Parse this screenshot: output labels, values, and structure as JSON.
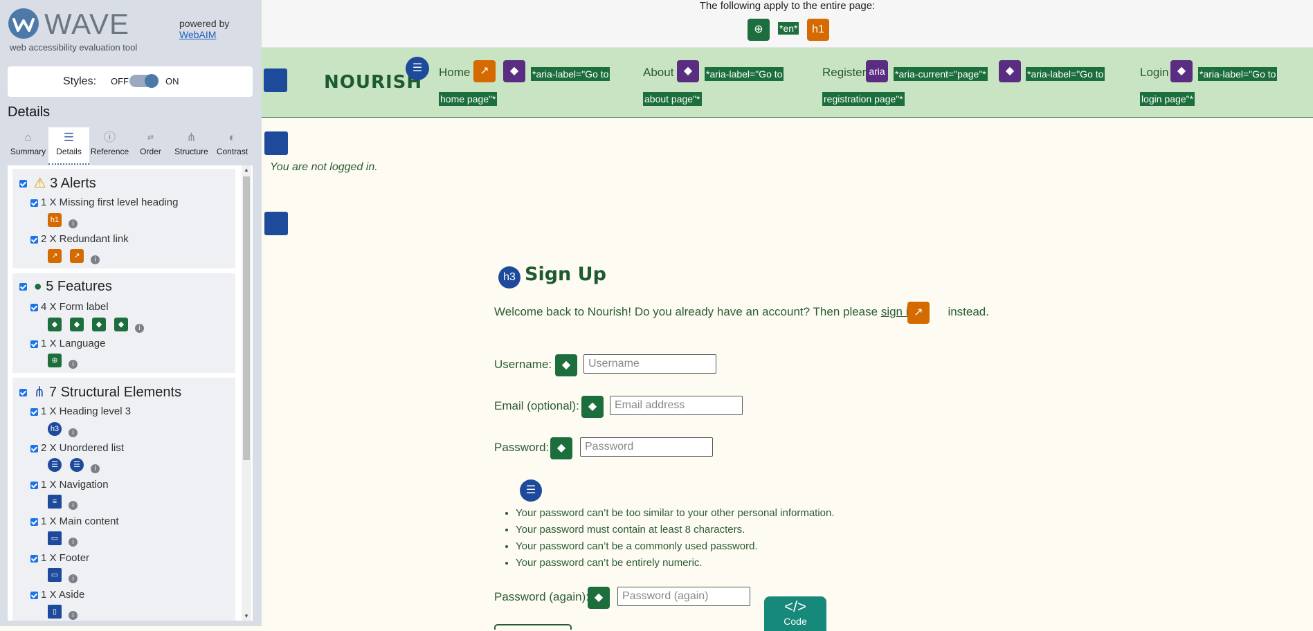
{
  "wave": {
    "logo_text": "WAVE",
    "subtitle": "web accessibility evaluation tool",
    "powered_by": "powered by",
    "webaim_link": "WebAIM",
    "styles_label": "Styles:",
    "styles_off": "OFF",
    "styles_on": "ON",
    "details_heading": "Details",
    "tabs": [
      {
        "label": "Summary",
        "icon": "home-icon"
      },
      {
        "label": "Details",
        "icon": "list-icon",
        "active": true
      },
      {
        "label": "Reference",
        "icon": "info-icon"
      },
      {
        "label": "Order",
        "icon": "order-icon"
      },
      {
        "label": "Structure",
        "icon": "structure-icon"
      },
      {
        "label": "Contrast",
        "icon": "contrast-icon"
      }
    ],
    "groups": {
      "alerts": {
        "title": "3 Alerts",
        "items": [
          "1 X Missing first level heading",
          "2 X Redundant link"
        ]
      },
      "features": {
        "title": "5 Features",
        "items": [
          "4 X Form label",
          "1 X Language"
        ]
      },
      "structure": {
        "title": "7 Structural Elements",
        "items": [
          "1 X Heading level 3",
          "2 X Unordered list",
          "1 X Navigation",
          "1 X Main content",
          "1 X Footer",
          "1 X Aside"
        ]
      }
    }
  },
  "page_top": {
    "applies_text": "The following apply to the entire page:",
    "lang_tag": "*en*",
    "h1_badge": "h1"
  },
  "nav": {
    "brand": "NOURISH",
    "links": {
      "home": "Home",
      "about": "About",
      "register": "Register",
      "login": "Login"
    },
    "aria_badge": "aria",
    "labels": {
      "home_1": "*aria-label=\"Go to",
      "home_2": "home page\"*",
      "about_1": "*aria-label=\"Go to",
      "about_2": "about page\"*",
      "reg_current": "*aria-current=\"page\"*",
      "reg_1": "*aria-label=\"Go to",
      "reg_2": "registration page\"*",
      "login_1": "*aria-label=\"Go to",
      "login_2": "login page\"*"
    }
  },
  "main": {
    "not_logged_in": "You are not logged in.",
    "h3_badge": "h3",
    "heading": "Sign Up",
    "welcome_before": "Welcome back to Nourish! Do you already have an account? Then please",
    "sign_in_link": "sign in",
    "welcome_after": "instead.",
    "fields": {
      "username_label": "Username:",
      "username_placeholder": "Username",
      "email_label": "Email (optional):",
      "email_placeholder": "Email address",
      "password_label": "Password:",
      "password_placeholder": "Password",
      "password2_label": "Password (again):",
      "password2_placeholder": "Password (again)"
    },
    "password_rules": [
      "Your password can’t be too similar to your other personal information.",
      "Your password must contain at least 8 characters.",
      "Your password can’t be a commonly used password.",
      "Your password can’t be entirely numeric."
    ],
    "code_button_symbol": "</>",
    "code_button": "Code"
  },
  "colors": {
    "nav_bg": "#c8e4c2",
    "feature_green": "#1d6e3d",
    "alert_orange": "#d46a00",
    "structure_blue": "#1e4a9c",
    "code_teal": "#16897a"
  }
}
